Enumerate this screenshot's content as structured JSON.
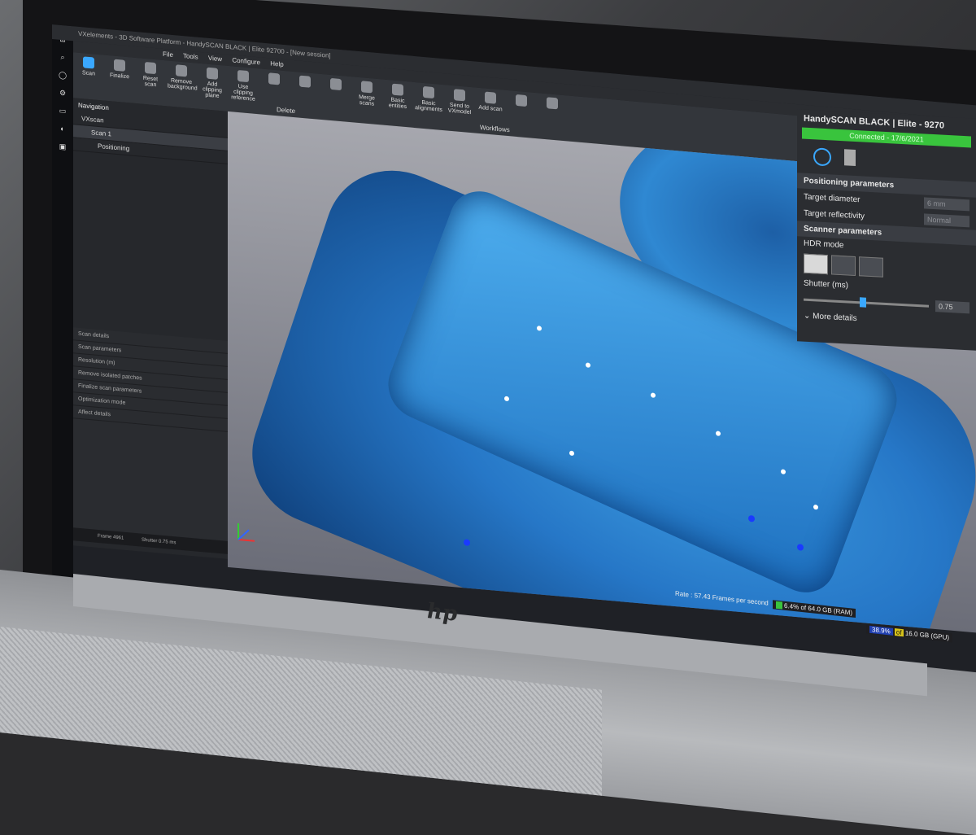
{
  "window": {
    "title": "VXelements - 3D Software Platform - HandySCAN BLACK | Elite 92700 - [New session]"
  },
  "menu": [
    "File",
    "Tools",
    "View",
    "Configure",
    "Help"
  ],
  "ribbon": {
    "buttons": [
      "Scan",
      "Finalize",
      "Reset scan",
      "Remove background",
      "Add clipping plane",
      "Use clipping reference",
      "",
      "",
      "",
      "Merge scans",
      "Basic entities",
      "Basic alignments",
      "Send to VXmodel",
      "Add scan",
      "",
      ""
    ],
    "groups": [
      "Delete",
      "Workflows"
    ]
  },
  "navigation": {
    "header": "Navigation",
    "items": [
      "VXscan",
      "Scan 1",
      "Positioning"
    ]
  },
  "details": {
    "rows": [
      "Scan details",
      "Scan parameters",
      "Resolution (m)",
      "Remove isolated patches",
      "Finalize scan parameters",
      "Optimization mode",
      "Affect details"
    ]
  },
  "statusbar": {
    "frame": "Frame 4961",
    "shutter": "Shutter 0.75 ms"
  },
  "scanner_panel": {
    "title": "HandySCAN BLACK | Elite - 9270",
    "connection": "Connected - 17/6/2021",
    "positioning_header": "Positioning parameters",
    "target_diameter_label": "Target diameter",
    "target_diameter_value": "6 mm",
    "target_reflectivity_label": "Target reflectivity",
    "target_reflectivity_value": "Normal",
    "scanner_header": "Scanner parameters",
    "hdr_label": "HDR mode",
    "shutter_label": "Shutter (ms)",
    "shutter_value": "0.75",
    "shutter_fraction": 0.45,
    "more": "More details"
  },
  "status": {
    "rate": "Rate : 57.43 Frames per second",
    "ram": "6.4% of 64.0 GB (RAM)",
    "gpu_pct": "38.9%",
    "gpu_of": "of",
    "gpu_rest": "16.0 GB (GPU)"
  },
  "brand": {
    "logo": "hp"
  },
  "colors": {
    "accent": "#3aa8ff",
    "connected": "#39c43d",
    "scan": "#2677c7"
  }
}
